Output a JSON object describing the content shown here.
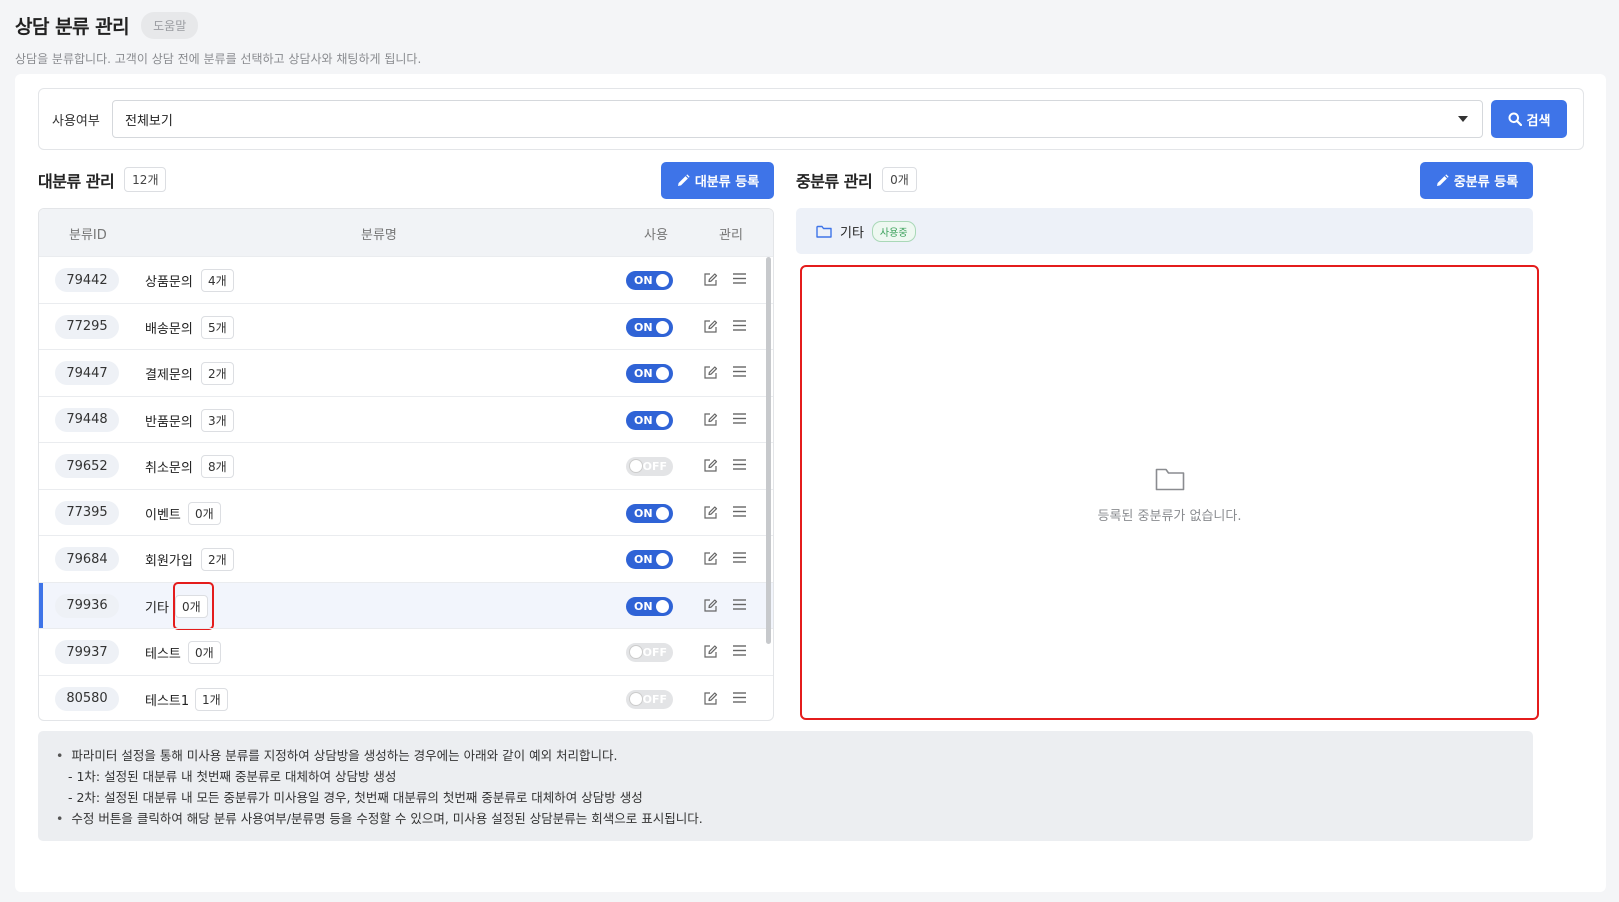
{
  "header": {
    "title": "상담 분류 관리",
    "help_label": "도움말",
    "description": "상담을 분류합니다. 고객이 상담 전에 분류를 선택하고 상담사와 채팅하게 됩니다."
  },
  "search": {
    "label": "사용여부",
    "selected": "전체보기",
    "button_label": "검색"
  },
  "major": {
    "title": "대분류 관리",
    "count": "12개",
    "register_label": "대분류 등록",
    "columns": {
      "id": "분류ID",
      "name": "분류명",
      "use": "사용",
      "manage": "관리"
    },
    "rows": [
      {
        "id": "79442",
        "name": "상품문의",
        "count": "4개",
        "status": "ON"
      },
      {
        "id": "77295",
        "name": "배송문의",
        "count": "5개",
        "status": "ON"
      },
      {
        "id": "79447",
        "name": "결제문의",
        "count": "2개",
        "status": "ON"
      },
      {
        "id": "79448",
        "name": "반품문의",
        "count": "3개",
        "status": "ON"
      },
      {
        "id": "79652",
        "name": "취소문의",
        "count": "8개",
        "status": "OFF"
      },
      {
        "id": "77395",
        "name": "이벤트",
        "count": "0개",
        "status": "ON"
      },
      {
        "id": "79684",
        "name": "회원가입",
        "count": "2개",
        "status": "ON"
      },
      {
        "id": "79936",
        "name": "기타",
        "count": "0개",
        "status": "ON"
      },
      {
        "id": "79937",
        "name": "테스트",
        "count": "0개",
        "status": "OFF"
      },
      {
        "id": "80580",
        "name": "테스트1",
        "count": "1개",
        "status": "OFF"
      }
    ]
  },
  "middle": {
    "title": "중분류 관리",
    "count": "0개",
    "register_label": "중분류 등록",
    "selected_category": "기타",
    "selected_status": "사용중",
    "empty_text": "등록된 중분류가 없습니다."
  },
  "notes": {
    "line1": "파라미터 설정을 통해 미사용 분류를 지정하여 상담방을 생성하는 경우에는 아래와 같이 예외 처리합니다.",
    "line2": "- 1차: 설정된 대분류 내 첫번째 중분류로 대체하여 상담방 생성",
    "line3": "- 2차: 설정된 대분류 내 모든 중분류가 미사용일 경우, 첫번째 대분류의 첫번째 중분류로 대체하여 상담방 생성",
    "line4": "수정 버튼을 클릭하여 해당 분류 사용여부/분류명 등을 수정할 수 있으며, 미사용 설정된 상담분류는 회색으로 표시됩니다."
  },
  "colors": {
    "accent": "#3e74e8",
    "toggle_on": "#2f63d6",
    "highlight": "#e41c1c",
    "selected_row": "#f2f5fc"
  }
}
